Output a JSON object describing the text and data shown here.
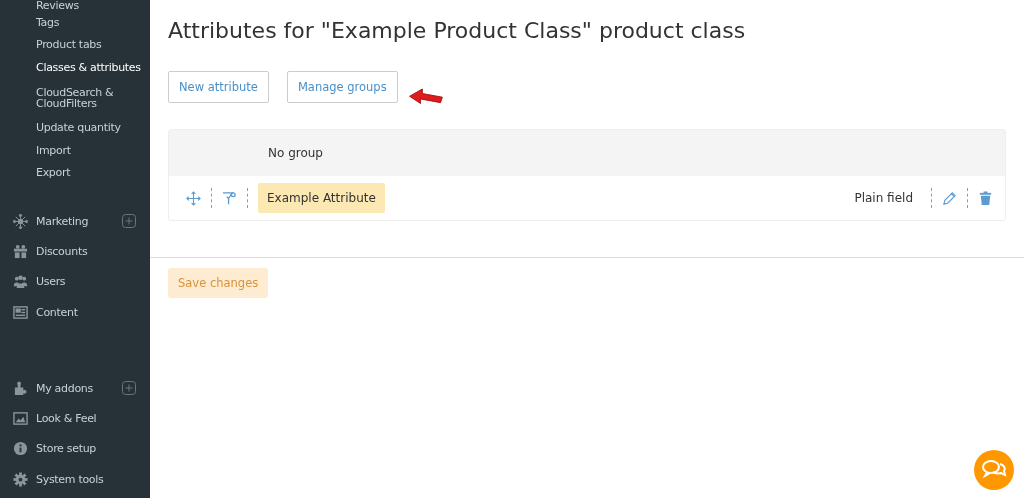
{
  "sidebar": {
    "subitems": [
      {
        "label": "Reviews",
        "selected": false
      },
      {
        "label": "Tags",
        "selected": false
      },
      {
        "label": "Product tabs",
        "selected": false
      },
      {
        "label": "Classes & attributes",
        "selected": true
      },
      {
        "label": "CloudSearch & CloudFilters",
        "selected": false
      },
      {
        "label": "Update quantity",
        "selected": false
      },
      {
        "label": "Import",
        "selected": false
      },
      {
        "label": "Export",
        "selected": false
      }
    ],
    "groups": [
      [
        {
          "label": "Marketing",
          "expandable": true
        },
        {
          "label": "Discounts",
          "expandable": false
        },
        {
          "label": "Users",
          "expandable": false
        },
        {
          "label": "Content",
          "expandable": false
        }
      ],
      [
        {
          "label": "My addons",
          "expandable": true
        },
        {
          "label": "Look & Feel",
          "expandable": false
        },
        {
          "label": "Store setup",
          "expandable": false
        },
        {
          "label": "System tools",
          "expandable": false
        }
      ]
    ]
  },
  "page": {
    "title": "Attributes for \"Example Product Class\" product class",
    "buttons": [
      "New attribute",
      "Manage groups"
    ],
    "groups": [
      {
        "name": "No group",
        "attributes": [
          {
            "name": "Example Attribute",
            "type": "Plain field"
          }
        ]
      }
    ],
    "save": {
      "label": "Save changes",
      "disabled": true
    }
  }
}
